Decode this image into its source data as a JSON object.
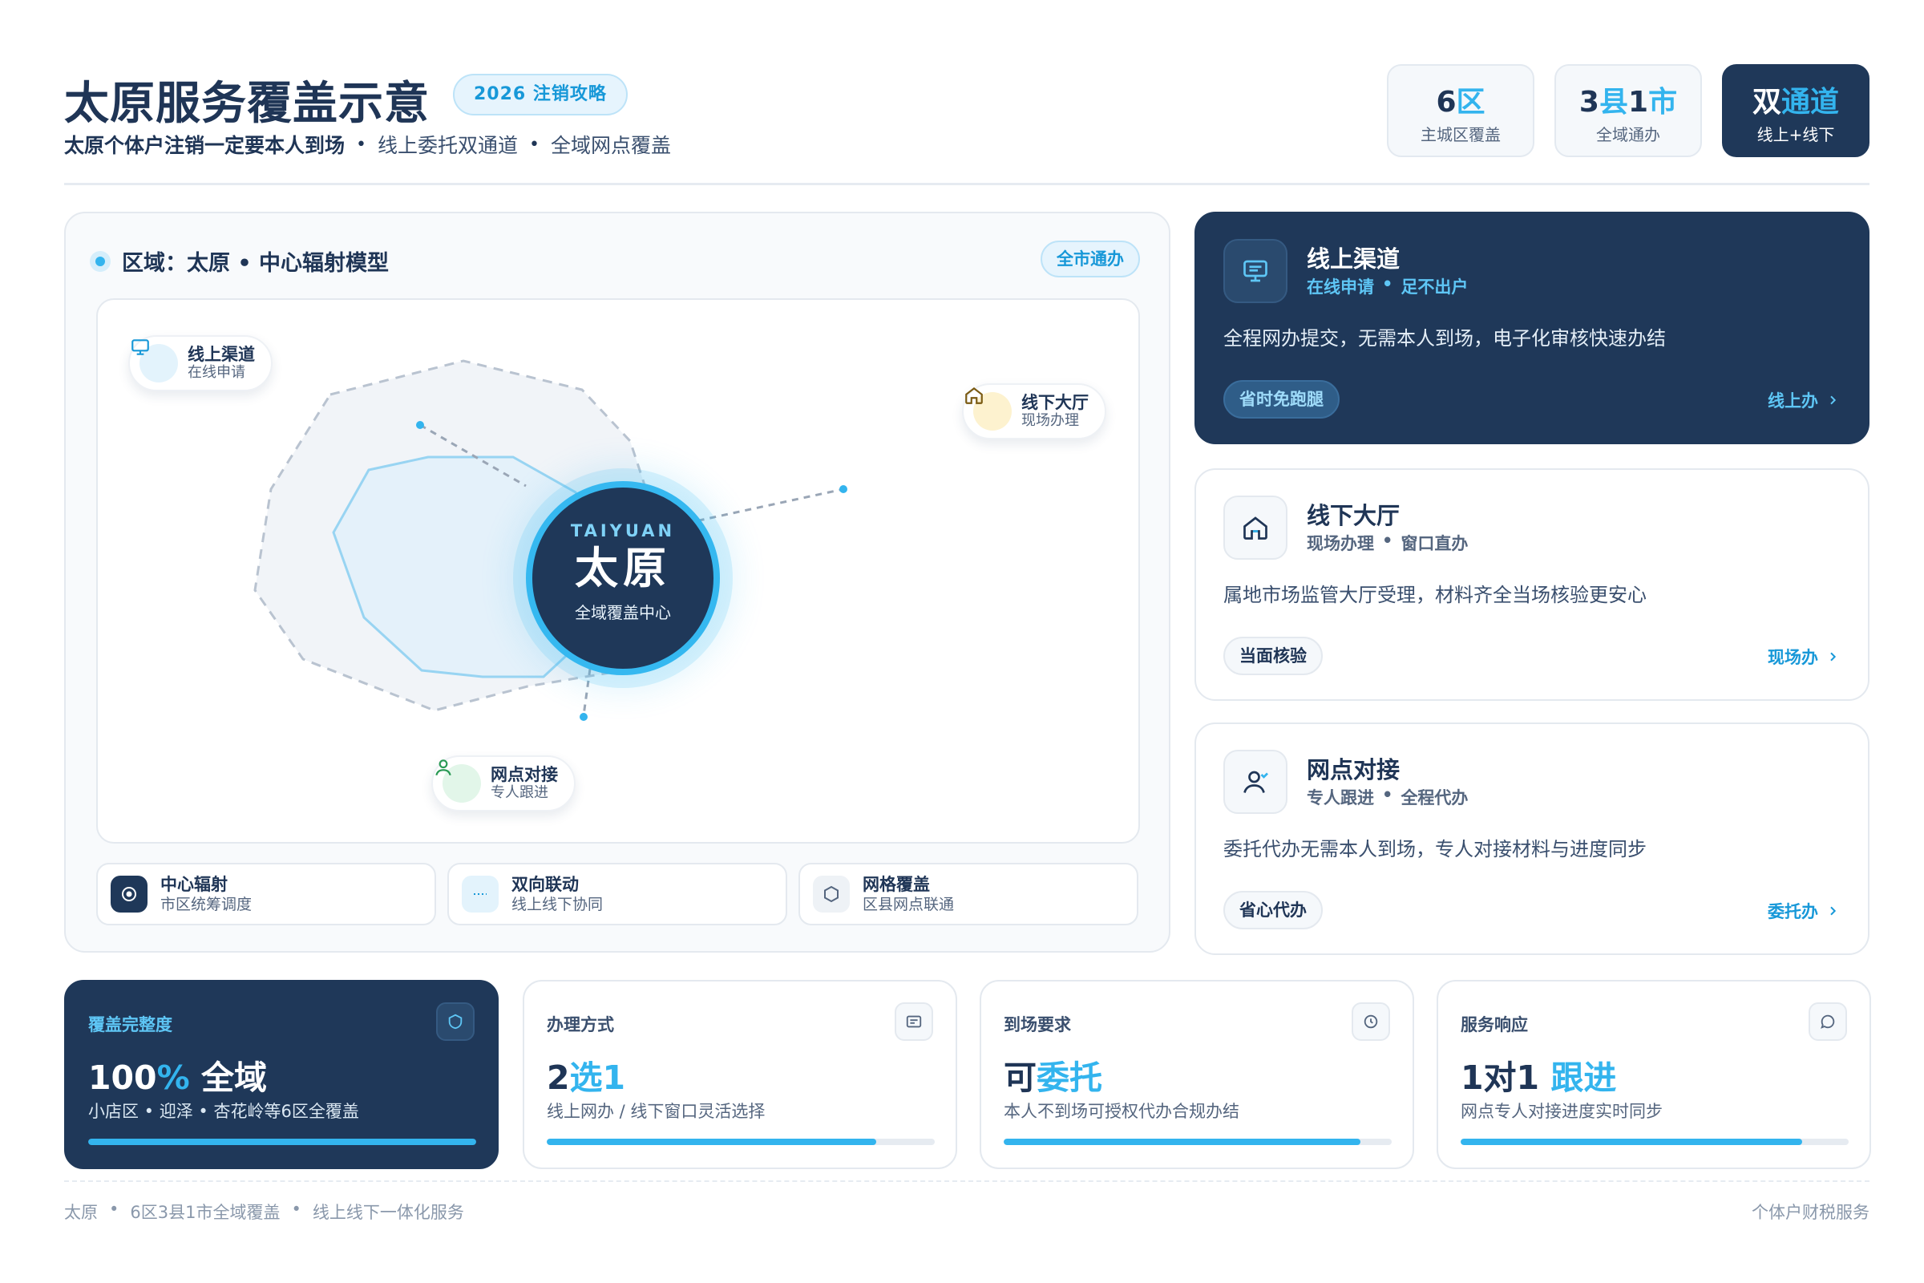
{
  "header": {
    "title": "太原服务覆盖示意",
    "badge": "2026 注销攻略",
    "subtitle": {
      "lead": "太原个体户注销一定要本人到场",
      "sep": "•",
      "item2": "线上委托双通道",
      "item3": "全域网点覆盖"
    },
    "stats": [
      {
        "num": "6",
        "acc": "区",
        "label": "主城区覆盖"
      },
      {
        "num": "3",
        "acc": "县",
        "num2": "1",
        "acc2": "市",
        "label": "全域通办"
      },
      {
        "num": "双",
        "acc": "通道",
        "label": "线上+线下"
      }
    ]
  },
  "map": {
    "heading": "区域：太原 • 中心辐射模型",
    "tag": "全市通办",
    "center": {
      "en": "TAIYUAN",
      "cn": "太原",
      "sub": "全域覆盖中心"
    },
    "pins": [
      {
        "title": "线上渠道",
        "sub": "在线申请",
        "icon": "monitor-icon"
      },
      {
        "title": "线下大厅",
        "sub": "现场办理",
        "icon": "home-icon"
      },
      {
        "title": "网点对接",
        "sub": "专人跟进",
        "icon": "person-icon"
      }
    ],
    "legend": [
      {
        "title": "中心辐射",
        "sub": "市区统筹调度",
        "icon": "target-icon"
      },
      {
        "title": "双向联动",
        "sub": "线上线下协同",
        "icon": "link-icon"
      },
      {
        "title": "网格覆盖",
        "sub": "区县网点联通",
        "icon": "hexagon-icon"
      }
    ]
  },
  "channels": [
    {
      "name": "线上渠道",
      "tag1": "在线申请",
      "tag2": "足不出户",
      "desc": "全程网办提交，无需本人到场，电子化审核快速办结",
      "pill": "省时免跑腿",
      "link": "线上办",
      "icon": "monitor-icon"
    },
    {
      "name": "线下大厅",
      "tag1": "现场办理",
      "tag2": "窗口直办",
      "desc": "属地市场监管大厅受理，材料齐全当场核验更安心",
      "pill": "当面核验",
      "link": "现场办",
      "icon": "home-icon"
    },
    {
      "name": "网点对接",
      "tag1": "专人跟进",
      "tag2": "全程代办",
      "desc": "委托代办无需本人到场，专人对接材料与进度同步",
      "pill": "省心代办",
      "link": "委托办",
      "icon": "person-icon"
    }
  ],
  "metrics": [
    {
      "label": "覆盖完整度",
      "v1": "100",
      "vacc": "%",
      "v2": " 全域",
      "note": "小店区 • 迎泽 • 杏花岭等6区全覆盖",
      "progress": 1.0,
      "icon": "shield-icon"
    },
    {
      "label": "办理方式",
      "v1": "2",
      "vacc": "选1",
      "v2": "",
      "note": "线上网办 / 线下窗口灵活选择",
      "progress": 0.85,
      "icon": "message-icon"
    },
    {
      "label": "到场要求",
      "v1": "可",
      "vacc": "委托",
      "v2": "",
      "note": "本人不到场可授权代办合规办结",
      "progress": 0.92,
      "icon": "clock-icon"
    },
    {
      "label": "服务响应",
      "v1": "1对1",
      "vacc": " 跟进",
      "v2": "",
      "note": "网点专人对接进度实时同步",
      "progress": 0.88,
      "icon": "chat-icon"
    }
  ],
  "footer": {
    "left1": "太原",
    "left2": "6区3县1市全域覆盖",
    "left3": "线上线下一体化服务",
    "sep": "•",
    "right": "个体户财税服务"
  },
  "colors": {
    "navy": "#1f3859",
    "accent": "#33b4ee",
    "text": "#1f3556"
  }
}
